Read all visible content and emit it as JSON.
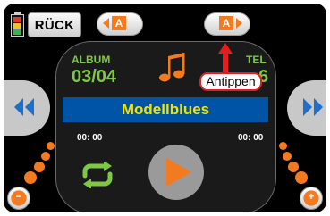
{
  "header": {
    "back_label": "RÜCK",
    "album_selector_left": "A",
    "album_selector_right": "A"
  },
  "album": {
    "label": "ALBUM",
    "value": "03/04"
  },
  "title": {
    "label": "TEL",
    "value": "6"
  },
  "track": {
    "name": "Modellblues",
    "time_elapsed": "00: 00",
    "time_total": "00: 00"
  },
  "controls": {
    "minus": "−",
    "plus": "+"
  },
  "tooltip": {
    "text": "Antippen"
  },
  "icons": {
    "battery": "battery-icon",
    "music_note": "music-note-icon",
    "repeat": "repeat-icon",
    "play": "play-icon",
    "previous": "previous-track-icon",
    "next": "next-track-icon"
  },
  "colors": {
    "accent_orange": "#f47a20",
    "label_green": "#7ec842",
    "title_bar_blue": "#0054a6",
    "title_text_yellow": "#f2e200",
    "tooltip_red": "#e02020"
  }
}
